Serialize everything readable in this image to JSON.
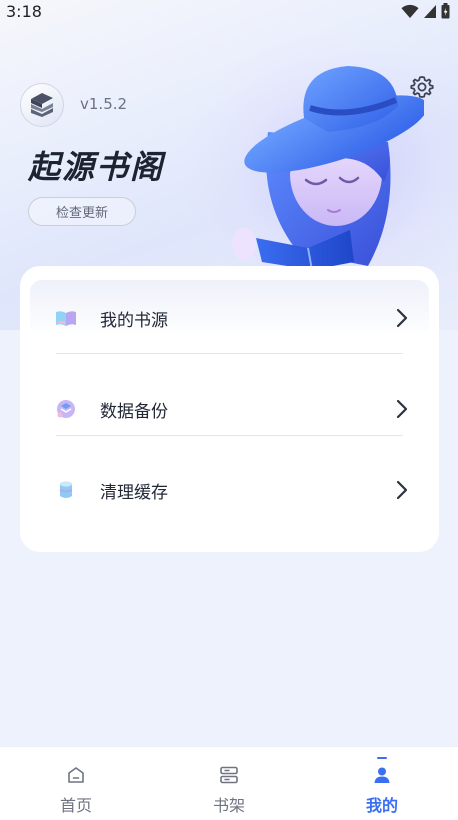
{
  "status_bar": {
    "time": "3:18"
  },
  "header": {
    "version": "v1.5.2",
    "app_title": "起源书阁",
    "check_update_label": "检查更新"
  },
  "menu": {
    "items": [
      {
        "label": "我的书源",
        "icon": "book-icon"
      },
      {
        "label": "数据备份",
        "icon": "backup-icon"
      },
      {
        "label": "清理缓存",
        "icon": "cache-cylinder-icon"
      }
    ]
  },
  "bottom_nav": {
    "items": [
      {
        "label": "首页",
        "icon": "home-icon",
        "active": false
      },
      {
        "label": "书架",
        "icon": "bookshelf-icon",
        "active": false
      },
      {
        "label": "我的",
        "icon": "profile-icon",
        "active": true
      }
    ]
  },
  "colors": {
    "accent": "#3a6ff2",
    "background": "#eef2fd",
    "card": "#ffffff"
  }
}
